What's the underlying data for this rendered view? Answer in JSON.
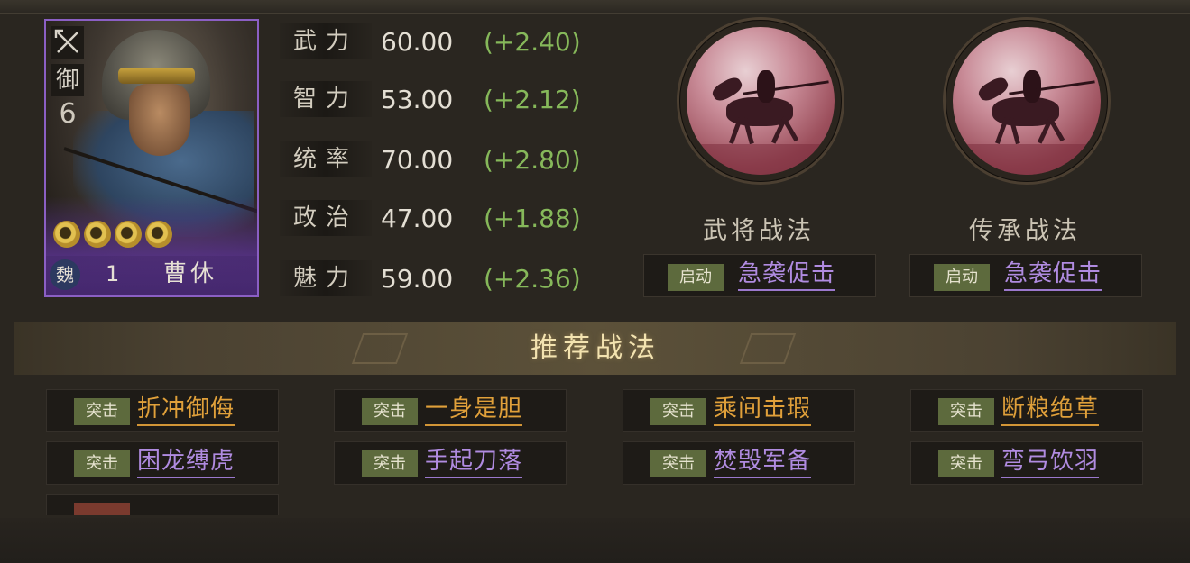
{
  "general": {
    "class_icon": "bow-icon",
    "class_glyph": "⚔",
    "troop_type": "御",
    "cost": "6",
    "star_count": 4,
    "faction": "魏",
    "level": "1",
    "name": "曹休"
  },
  "stats": [
    {
      "label": "武力",
      "value": "60.00",
      "bonus": "(+2.40)"
    },
    {
      "label": "智力",
      "value": "53.00",
      "bonus": "(+2.12)"
    },
    {
      "label": "统率",
      "value": "70.00",
      "bonus": "(+2.80)"
    },
    {
      "label": "政治",
      "value": "47.00",
      "bonus": "(+1.88)"
    },
    {
      "label": "魅力",
      "value": "59.00",
      "bonus": "(+2.36)"
    }
  ],
  "tactics": {
    "general": {
      "title": "武将战法",
      "tag": "启动",
      "name": "急袭促击"
    },
    "inherit": {
      "title": "传承战法",
      "tag": "启动",
      "name": "急袭促击"
    }
  },
  "recommended": {
    "title": "推荐战法",
    "items": [
      {
        "tag": "突击",
        "name": "折冲御侮",
        "color": "orange"
      },
      {
        "tag": "突击",
        "name": "一身是胆",
        "color": "orange"
      },
      {
        "tag": "突击",
        "name": "乘间击瑕",
        "color": "orange"
      },
      {
        "tag": "突击",
        "name": "断粮绝草",
        "color": "orange"
      },
      {
        "tag": "突击",
        "name": "困龙缚虎",
        "color": "purple"
      },
      {
        "tag": "突击",
        "name": "手起刀落",
        "color": "purple"
      },
      {
        "tag": "突击",
        "name": "焚毁军备",
        "color": "purple"
      },
      {
        "tag": "突击",
        "name": "弯弓饮羽",
        "color": "purple"
      }
    ]
  },
  "colors": {
    "card_border": "#8b5fc4",
    "stat_bonus": "#86b85a",
    "purple_tactic": "#b08be0",
    "orange_tactic": "#e0a03a",
    "tag_bg": "#5d6a3d"
  }
}
